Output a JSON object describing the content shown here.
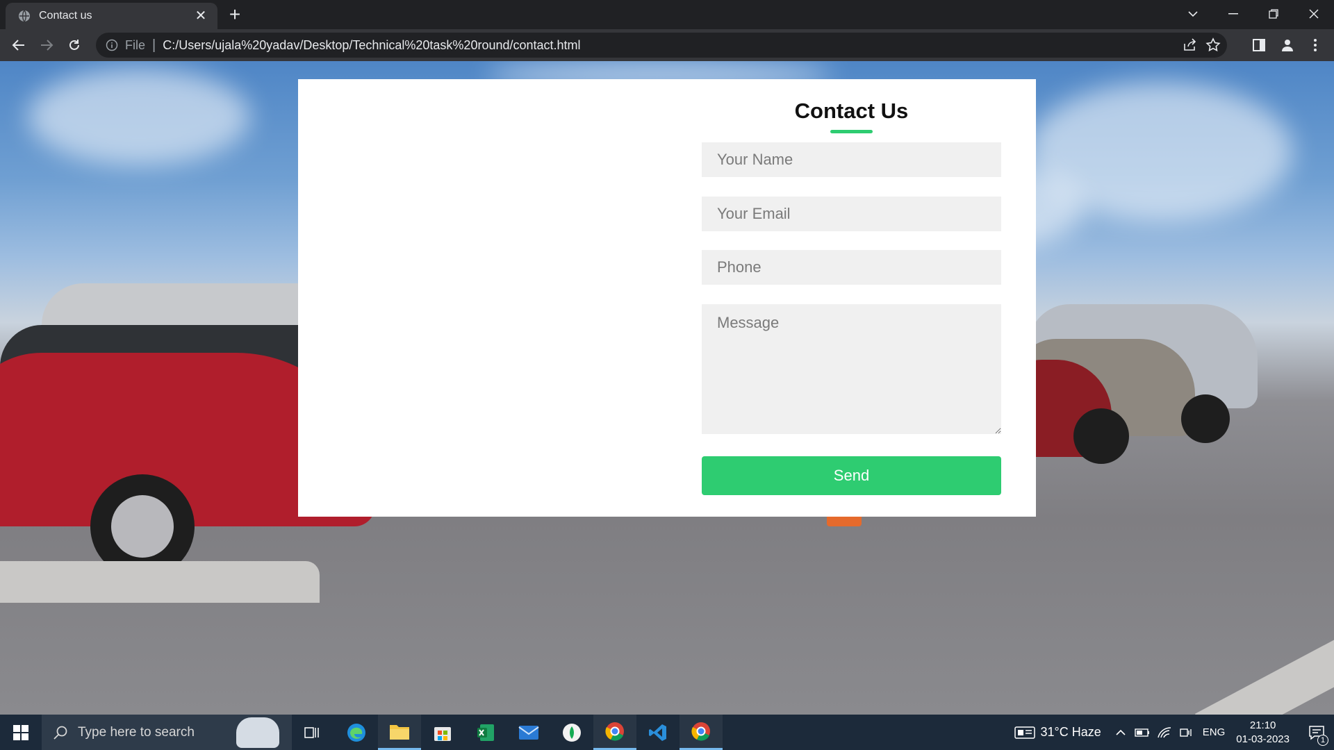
{
  "browser": {
    "tab_title": "Contact us",
    "new_tab_symbol": "+",
    "omnibox": {
      "scheme_label": "File",
      "url": "C:/Users/ujala%20yadav/Desktop/Technical%20task%20round/contact.html"
    }
  },
  "page": {
    "heading": "Contact Us",
    "name_placeholder": "Your Name",
    "email_placeholder": "Your Email",
    "phone_placeholder": "Phone",
    "message_placeholder": "Message",
    "send_label": "Send",
    "accent_color": "#2ecc71"
  },
  "taskbar": {
    "search_placeholder": "Type here to search",
    "weather": "31°C  Haze",
    "language": "ENG",
    "time": "21:10",
    "date": "01-03-2023",
    "notification_count": "1"
  }
}
